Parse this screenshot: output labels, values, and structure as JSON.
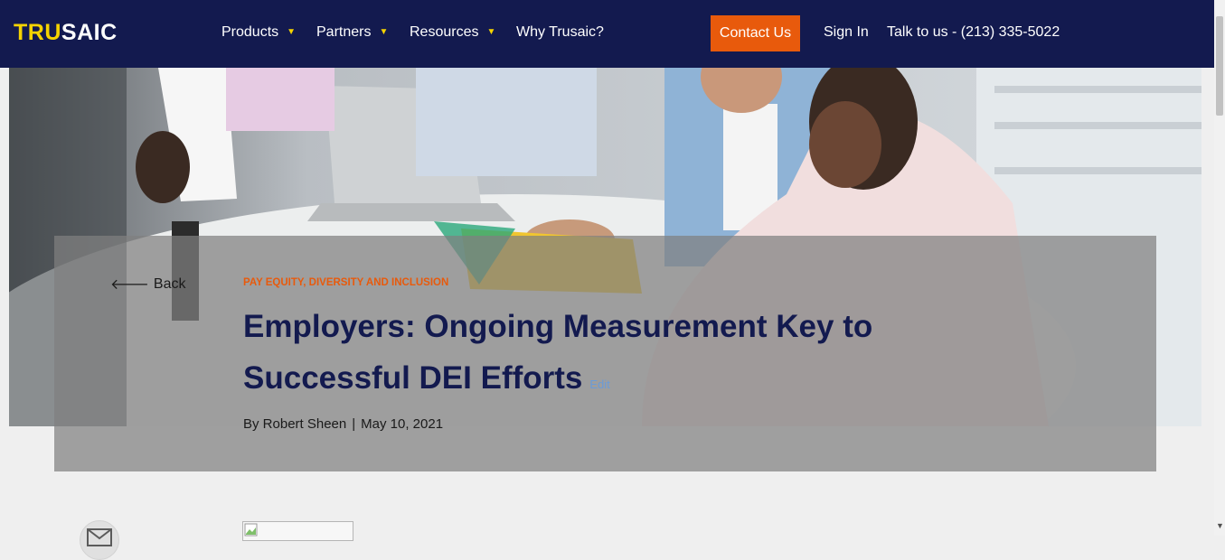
{
  "nav": {
    "logo_part1": "TRU",
    "logo_part2": "SAIC",
    "items": [
      {
        "label": "Products",
        "has_dropdown": true
      },
      {
        "label": "Partners",
        "has_dropdown": true
      },
      {
        "label": "Resources",
        "has_dropdown": true
      },
      {
        "label": "Why Trusaic?",
        "has_dropdown": false
      }
    ],
    "contact_label": "Contact Us",
    "signin_label": "Sign In",
    "phone_label": "Talk to us - (213) 335-5022"
  },
  "article": {
    "back_label": "Back",
    "category": "PAY EQUITY, DIVERSITY AND INCLUSION",
    "title": "Employers: Ongoing Measurement Key to Successful DEI Efforts",
    "edit_label": "Edit",
    "author": "By Robert Sheen",
    "separator": "|",
    "date": "May 10, 2021"
  },
  "colors": {
    "nav_bg": "#131a4f",
    "logo_accent": "#f5d300",
    "cta": "#e85a0c",
    "title": "#131a4f",
    "category": "#e85a0c"
  },
  "icons": [
    "chevron-down-icon",
    "arrow-left-icon",
    "mail-icon",
    "broken-image-icon"
  ]
}
